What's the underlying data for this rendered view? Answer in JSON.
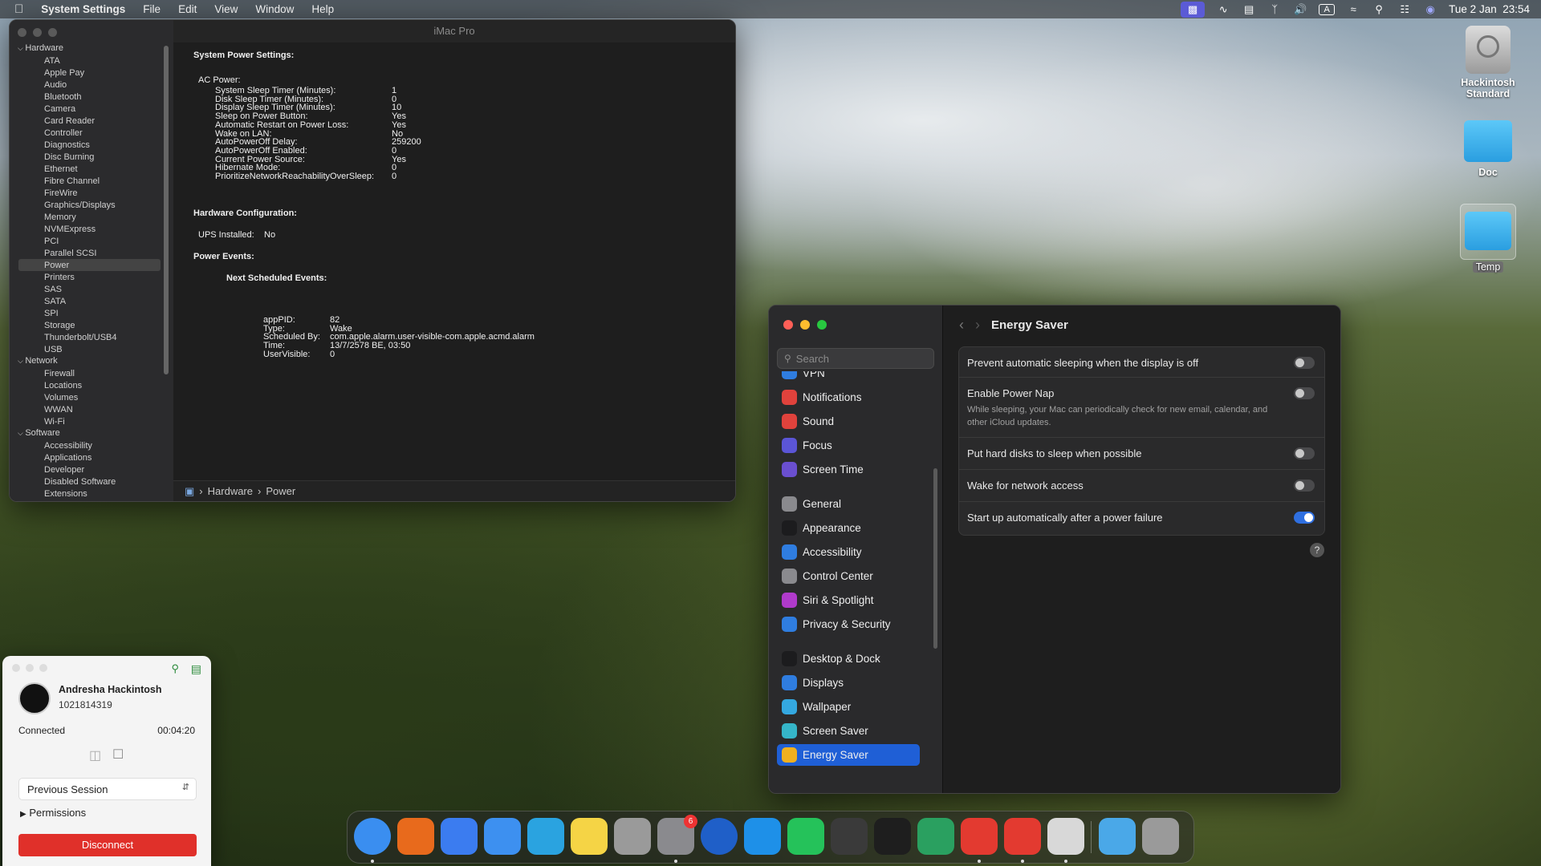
{
  "menubar": {
    "app": "System Settings",
    "menus": [
      "File",
      "Edit",
      "View",
      "Window",
      "Help"
    ],
    "datetime": "Tue 2 Jan  23:54",
    "input_badge": "A"
  },
  "sysinfo": {
    "title": "iMac Pro",
    "tree": [
      {
        "type": "grp",
        "label": "Hardware"
      },
      {
        "type": "item",
        "label": "ATA"
      },
      {
        "type": "item",
        "label": "Apple Pay"
      },
      {
        "type": "item",
        "label": "Audio"
      },
      {
        "type": "item",
        "label": "Bluetooth"
      },
      {
        "type": "item",
        "label": "Camera"
      },
      {
        "type": "item",
        "label": "Card Reader"
      },
      {
        "type": "item",
        "label": "Controller"
      },
      {
        "type": "item",
        "label": "Diagnostics"
      },
      {
        "type": "item",
        "label": "Disc Burning"
      },
      {
        "type": "item",
        "label": "Ethernet"
      },
      {
        "type": "item",
        "label": "Fibre Channel"
      },
      {
        "type": "item",
        "label": "FireWire"
      },
      {
        "type": "item",
        "label": "Graphics/Displays"
      },
      {
        "type": "item",
        "label": "Memory"
      },
      {
        "type": "item",
        "label": "NVMExpress"
      },
      {
        "type": "item",
        "label": "PCI"
      },
      {
        "type": "item",
        "label": "Parallel SCSI"
      },
      {
        "type": "item",
        "label": "Power",
        "selected": true
      },
      {
        "type": "item",
        "label": "Printers"
      },
      {
        "type": "item",
        "label": "SAS"
      },
      {
        "type": "item",
        "label": "SATA"
      },
      {
        "type": "item",
        "label": "SPI"
      },
      {
        "type": "item",
        "label": "Storage"
      },
      {
        "type": "item",
        "label": "Thunderbolt/USB4"
      },
      {
        "type": "item",
        "label": "USB"
      },
      {
        "type": "grp",
        "label": "Network"
      },
      {
        "type": "item",
        "label": "Firewall"
      },
      {
        "type": "item",
        "label": "Locations"
      },
      {
        "type": "item",
        "label": "Volumes"
      },
      {
        "type": "item",
        "label": "WWAN"
      },
      {
        "type": "item",
        "label": "Wi-Fi"
      },
      {
        "type": "grp",
        "label": "Software"
      },
      {
        "type": "item",
        "label": "Accessibility"
      },
      {
        "type": "item",
        "label": "Applications"
      },
      {
        "type": "item",
        "label": "Developer"
      },
      {
        "type": "item",
        "label": "Disabled Software"
      },
      {
        "type": "item",
        "label": "Extensions"
      }
    ],
    "heading_power": "System Power Settings:",
    "ac_power": "AC Power:",
    "settings": [
      [
        "System Sleep Timer (Minutes):",
        "1"
      ],
      [
        "Disk Sleep Timer (Minutes):",
        "0"
      ],
      [
        "Display Sleep Timer (Minutes):",
        "10"
      ],
      [
        "Sleep on Power Button:",
        "Yes"
      ],
      [
        "Automatic Restart on Power Loss:",
        "Yes"
      ],
      [
        "Wake on LAN:",
        "No"
      ],
      [
        "AutoPowerOff Delay:",
        "259200"
      ],
      [
        "AutoPowerOff Enabled:",
        "0"
      ],
      [
        "Current Power Source:",
        "Yes"
      ],
      [
        "Hibernate Mode:",
        "0"
      ],
      [
        "PrioritizeNetworkReachabilityOverSleep:",
        "0"
      ]
    ],
    "heading_hw": "Hardware Configuration:",
    "ups_label": "UPS Installed:",
    "ups_value": "No",
    "heading_events": "Power Events:",
    "heading_next": "Next Scheduled Events:",
    "events": [
      [
        "appPID:",
        "82"
      ],
      [
        "Type:",
        "Wake"
      ],
      [
        "Scheduled By:",
        "com.apple.alarm.user-visible-com.apple.acmd.alarm"
      ],
      [
        "Time:",
        "13/7/2578 BE, 03:50"
      ],
      [
        "UserVisible:",
        "0"
      ]
    ],
    "path": [
      "Hardware",
      "Power"
    ]
  },
  "settings": {
    "search_placeholder": "Search",
    "partial_item": "VPN",
    "nav": [
      {
        "label": "Notifications",
        "color": "#e0423c",
        "icon": "bell-icon"
      },
      {
        "label": "Sound",
        "color": "#e0423c",
        "icon": "speaker-icon"
      },
      {
        "label": "Focus",
        "color": "#5b55d6",
        "icon": "moon-icon"
      },
      {
        "label": "Screen Time",
        "color": "#6a4fd0",
        "icon": "hourglass-icon"
      },
      {
        "label": "General",
        "color": "#8a8a8e",
        "icon": "gear-icon"
      },
      {
        "label": "Appearance",
        "color": "#1c1c1e",
        "icon": "appearance-icon"
      },
      {
        "label": "Accessibility",
        "color": "#2f7de0",
        "icon": "accessibility-icon"
      },
      {
        "label": "Control Center",
        "color": "#8a8a8e",
        "icon": "control-center-icon"
      },
      {
        "label": "Siri & Spotlight",
        "color": "#b03acb",
        "icon": "siri-icon"
      },
      {
        "label": "Privacy & Security",
        "color": "#2f7de0",
        "icon": "hand-icon"
      },
      {
        "label": "Desktop & Dock",
        "color": "#1c1c1e",
        "icon": "dock-icon"
      },
      {
        "label": "Displays",
        "color": "#2f7de0",
        "icon": "sun-icon"
      },
      {
        "label": "Wallpaper",
        "color": "#34a8e0",
        "icon": "flower-icon"
      },
      {
        "label": "Screen Saver",
        "color": "#35b5c8",
        "icon": "screensaver-icon"
      },
      {
        "label": "Energy Saver",
        "color": "#f0b020",
        "icon": "bulb-icon",
        "selected": true
      }
    ],
    "title": "Energy Saver",
    "options": [
      {
        "label": "Prevent automatic sleeping when the display is off",
        "on": false
      },
      {
        "label": "Enable Power Nap",
        "desc": "While sleeping, your Mac can periodically check for new email, calendar, and other iCloud updates.",
        "on": false
      },
      {
        "label": "Put hard disks to sleep when possible",
        "on": false
      },
      {
        "label": "Wake for network access",
        "on": false
      },
      {
        "label": "Start up automatically after a power failure",
        "on": true
      }
    ],
    "help": "?"
  },
  "desktop": {
    "icons": [
      "Hackintosh Standard",
      "Doc",
      "Temp"
    ]
  },
  "teamviewer": {
    "name": "Andresha Hackintosh",
    "id": "1021814319",
    "status": "Connected",
    "timer": "00:04:20",
    "session": "Previous Session",
    "permissions": "Permissions",
    "disconnect": "Disconnect"
  },
  "dock": {
    "apps": [
      {
        "name": "finder-icon",
        "color": "#3a8ef0"
      },
      {
        "name": "firefox-icon",
        "color": "#e86a1c"
      },
      {
        "name": "shortcuts-icon",
        "color": "#3b7cf0"
      },
      {
        "name": "mail-icon",
        "color": "#3d90f0"
      },
      {
        "name": "telegram-icon",
        "color": "#2aa3e0"
      },
      {
        "name": "notes-icon",
        "color": "#f5d445"
      },
      {
        "name": "launchpad-icon",
        "color": "#9a9a9a"
      },
      {
        "name": "system-settings-icon",
        "color": "#8a8a8e"
      },
      {
        "name": "mercury-icon",
        "color": "#1f5fc8"
      },
      {
        "name": "skype-icon",
        "color": "#1e90e8"
      },
      {
        "name": "whatsapp-icon",
        "color": "#25c25a"
      },
      {
        "name": "calculator-icon",
        "color": "#3a3a3a"
      },
      {
        "name": "terminal-icon",
        "color": "#1e1e1e"
      },
      {
        "name": "network-icon",
        "color": "#2aa060"
      },
      {
        "name": "anydesk-icon",
        "color": "#e33a30"
      },
      {
        "name": "anydesk-2-icon",
        "color": "#e33a30"
      },
      {
        "name": "automator-icon",
        "color": "#d8d8d8"
      },
      {
        "name": "downloads-icon",
        "color": "#4aa8e8"
      },
      {
        "name": "trash-icon",
        "color": "#9a9a9a"
      }
    ],
    "badge": "6"
  }
}
